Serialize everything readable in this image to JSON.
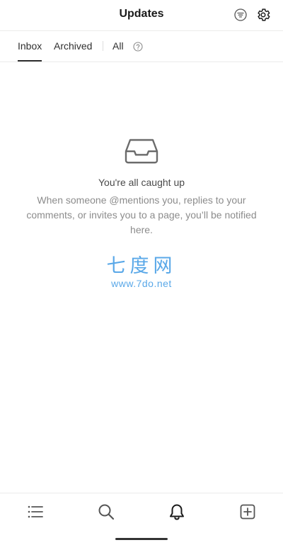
{
  "header": {
    "title": "Updates",
    "filter_icon": "filter-lines-icon",
    "settings_icon": "gear-icon"
  },
  "tabs": {
    "items": [
      {
        "label": "Inbox",
        "active": true
      },
      {
        "label": "Archived",
        "active": false
      },
      {
        "label": "All",
        "active": false
      }
    ],
    "help_icon": "question-circle-icon"
  },
  "empty_state": {
    "icon": "inbox-tray-icon",
    "title": "You're all caught up",
    "message": "When someone @mentions you, replies to your comments, or invites you to a page, you’ll be notified here."
  },
  "watermark": {
    "text": "七度网",
    "url": "www.7do.net",
    "color": "#5aa8e8"
  },
  "bottom_nav": {
    "items": [
      {
        "icon": "list-icon"
      },
      {
        "icon": "search-icon"
      },
      {
        "icon": "bell-icon",
        "active": true
      },
      {
        "icon": "new-page-icon"
      }
    ]
  },
  "colors": {
    "text_primary": "#1a1a1a",
    "text_secondary": "#8c8c8c",
    "divider": "#ebebea"
  }
}
